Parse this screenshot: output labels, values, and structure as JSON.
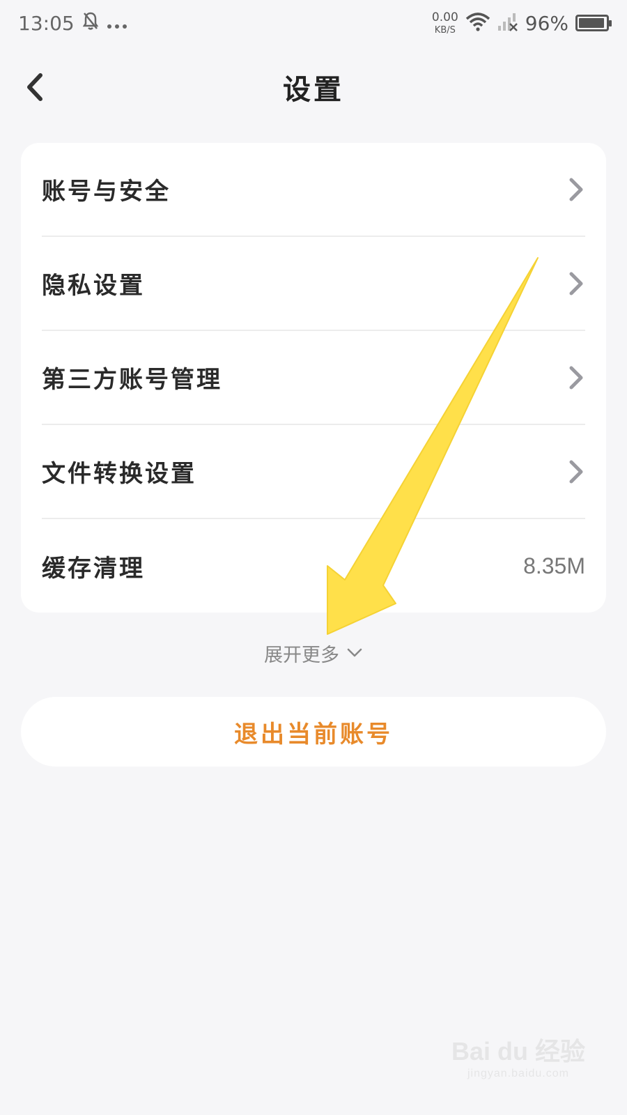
{
  "status_bar": {
    "time": "13:05",
    "net_speed_value": "0.00",
    "net_speed_unit": "KB/S",
    "battery_percent": "96%",
    "battery_level": 0.96,
    "icons": [
      "mute-bell-icon",
      "more-dots-icon",
      "wifi-icon",
      "signal-icon",
      "battery-icon"
    ]
  },
  "header": {
    "title": "设置",
    "back_icon": "chevron-left-icon"
  },
  "settings": {
    "items": [
      {
        "label": "账号与安全",
        "icon": "chevron-right-icon"
      },
      {
        "label": "隐私设置",
        "icon": "chevron-right-icon"
      },
      {
        "label": "第三方账号管理",
        "icon": "chevron-right-icon"
      },
      {
        "label": "文件转换设置",
        "icon": "chevron-right-icon"
      },
      {
        "label": "缓存清理",
        "value": "8.35M"
      }
    ]
  },
  "expand_more": {
    "label": "展开更多",
    "icon": "chevron-down-icon"
  },
  "logout": {
    "label": "退出当前账号"
  },
  "colors": {
    "background": "#f6f6f8",
    "card": "#ffffff",
    "accent": "#e88a2b",
    "annotation_arrow": "#ffe04a"
  },
  "watermark": {
    "brand": "Bai du 经验",
    "url": "jingyan.baidu.com"
  }
}
